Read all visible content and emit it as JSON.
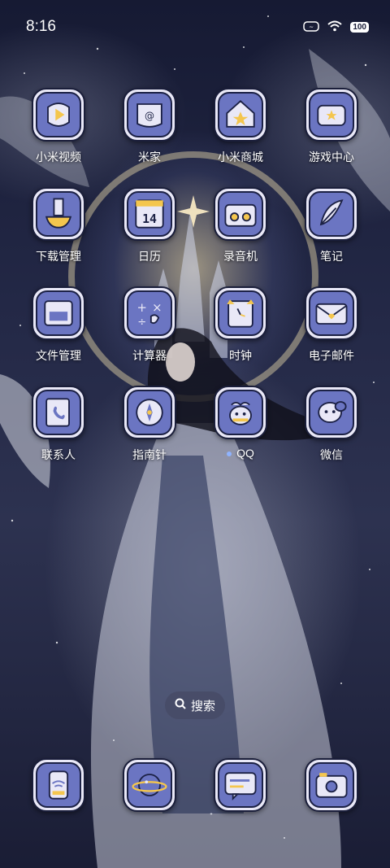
{
  "status_bar": {
    "time": "8:16",
    "battery": "100"
  },
  "apps": [
    {
      "label": "小米视频",
      "icon": "video-player-icon"
    },
    {
      "label": "米家",
      "icon": "home-control-icon"
    },
    {
      "label": "小米商城",
      "icon": "store-house-icon"
    },
    {
      "label": "游戏中心",
      "icon": "game-console-icon"
    },
    {
      "label": "下载管理",
      "icon": "download-icon"
    },
    {
      "label": "日历",
      "icon": "calendar-icon",
      "day": "14"
    },
    {
      "label": "录音机",
      "icon": "radio-recorder-icon"
    },
    {
      "label": "笔记",
      "icon": "feather-pen-icon"
    },
    {
      "label": "文件管理",
      "icon": "folder-icon"
    },
    {
      "label": "计算器",
      "icon": "calculator-icon"
    },
    {
      "label": "时钟",
      "icon": "clock-icon"
    },
    {
      "label": "电子邮件",
      "icon": "envelope-icon"
    },
    {
      "label": "联系人",
      "icon": "contact-book-icon"
    },
    {
      "label": "指南针",
      "icon": "compass-icon"
    },
    {
      "label": "QQ",
      "icon": "qq-penguin-icon"
    },
    {
      "label": "微信",
      "icon": "chat-bubbles-icon"
    }
  ],
  "search": {
    "label": "搜索"
  },
  "dock": [
    {
      "icon": "phone-walkie-icon"
    },
    {
      "icon": "planet-browser-icon"
    },
    {
      "icon": "message-icon"
    },
    {
      "icon": "camera-icon"
    }
  ],
  "colors": {
    "icon_fill": "#6b75c2",
    "icon_frame": "#e9e8f7",
    "accent": "#f4c64e"
  }
}
